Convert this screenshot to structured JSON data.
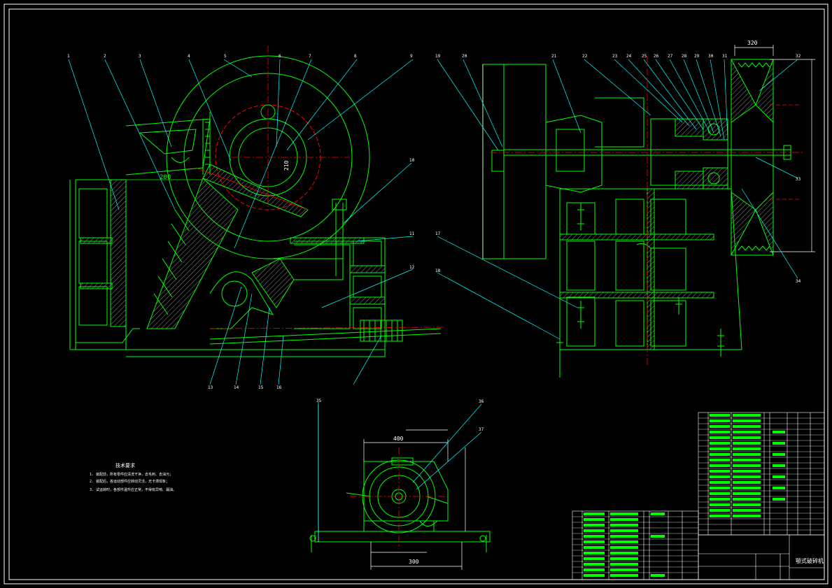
{
  "drawing": {
    "border_color": "#ffffff",
    "geometry_color": "#00ff00",
    "leader_color": "#00ffff",
    "centerline_color": "#ff0000",
    "hatch_color": "#8a8a8a",
    "background": "#000000"
  },
  "front_view": {
    "callouts": [
      "1",
      "2",
      "3",
      "4",
      "5",
      "6",
      "7",
      "8",
      "9",
      "10",
      "11",
      "12",
      "13",
      "14",
      "15",
      "16"
    ],
    "dimension_200": "200",
    "dimension_210": "210"
  },
  "side_view": {
    "callouts": [
      "17",
      "18",
      "19",
      "20",
      "21",
      "22",
      "23",
      "24",
      "25",
      "26",
      "27",
      "28",
      "29",
      "30",
      "31",
      "32",
      "33",
      "34"
    ],
    "top_dimension": "320"
  },
  "motor_view": {
    "callouts": [
      "35",
      "36",
      "37"
    ],
    "dimension_400": "400",
    "dimension_bottom": "300"
  },
  "technical_requirements": {
    "title": "技术要求",
    "items": [
      "1. 装配前，所有零件应清洗干净，去毛刺、去油污；",
      "2. 装配后，各运动部件应转动灵活，无卡滞现象；",
      "3. 试运转时，各部件温升应正常，不得有异响、漏油。"
    ]
  },
  "title_block": {
    "drawing_name": "颚式破碎机"
  }
}
